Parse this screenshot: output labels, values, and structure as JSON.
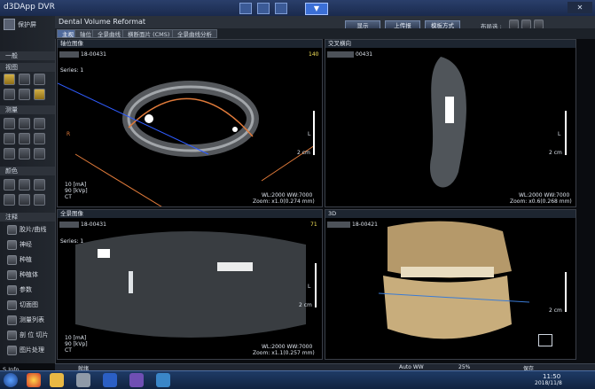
{
  "window": {
    "title": "d3DApp  DVR"
  },
  "header": {
    "title": "Dental Volume Reformat",
    "buttons": [
      "显示",
      "上传报",
      "模板方式"
    ],
    "layout_label": "布局选 :"
  },
  "tabs": [
    "主视",
    "轴位",
    "全景曲线",
    "横断面片 (CMS)",
    "全景曲线分析"
  ],
  "sidebar": {
    "top_label": "保护屏",
    "sections": [
      "一般",
      "视图",
      "测量",
      "颜色",
      "注释"
    ],
    "items": [
      "胶片/曲线",
      "神经",
      "种植",
      "种植体",
      "参数",
      "切面图",
      "测量列表",
      "剖 位 切片",
      "图片处理"
    ],
    "bottom_label": "S Info."
  },
  "viewports": {
    "axial": {
      "label": "轴位图像",
      "patient_id": "18-00431",
      "series": "Series: 1",
      "slice": "140",
      "mark_left": "R",
      "mark_right": "L",
      "unit": "2 cm",
      "ma": "10 [mA]",
      "kvp": "90 [kVp]",
      "modality": "CT",
      "wlww": "WL:2000 WW:7000",
      "zoom": "Zoom: x1.0(0.274 mm)"
    },
    "cross": {
      "label": "交叉横向",
      "patient_id": "00431",
      "mark_right": "L",
      "unit": "2 cm",
      "wlww": "WL:2000 WW:7000",
      "zoom": "Zoom: x0.6(0.268 mm)"
    },
    "pano": {
      "label": "全景图像",
      "patient_id": "18-00431",
      "series": "Series: 1",
      "slice": "71",
      "mark_right": "L",
      "unit": "2 cm",
      "ma": "10 [mA]",
      "kvp": "90 [kVp]",
      "modality": "CT",
      "wlww": "WL:2000 WW:7000",
      "zoom": "Zoom: x1.1(0.257 mm)"
    },
    "volume": {
      "label": "3D",
      "patient_id": "18-00421",
      "unit": "2 cm"
    }
  },
  "status": {
    "left": "就绪",
    "mid": "Auto WW",
    "mid2": "25%",
    "right": "保存"
  },
  "taskbar": {
    "time": "11:50",
    "date": "2018/11/8"
  }
}
